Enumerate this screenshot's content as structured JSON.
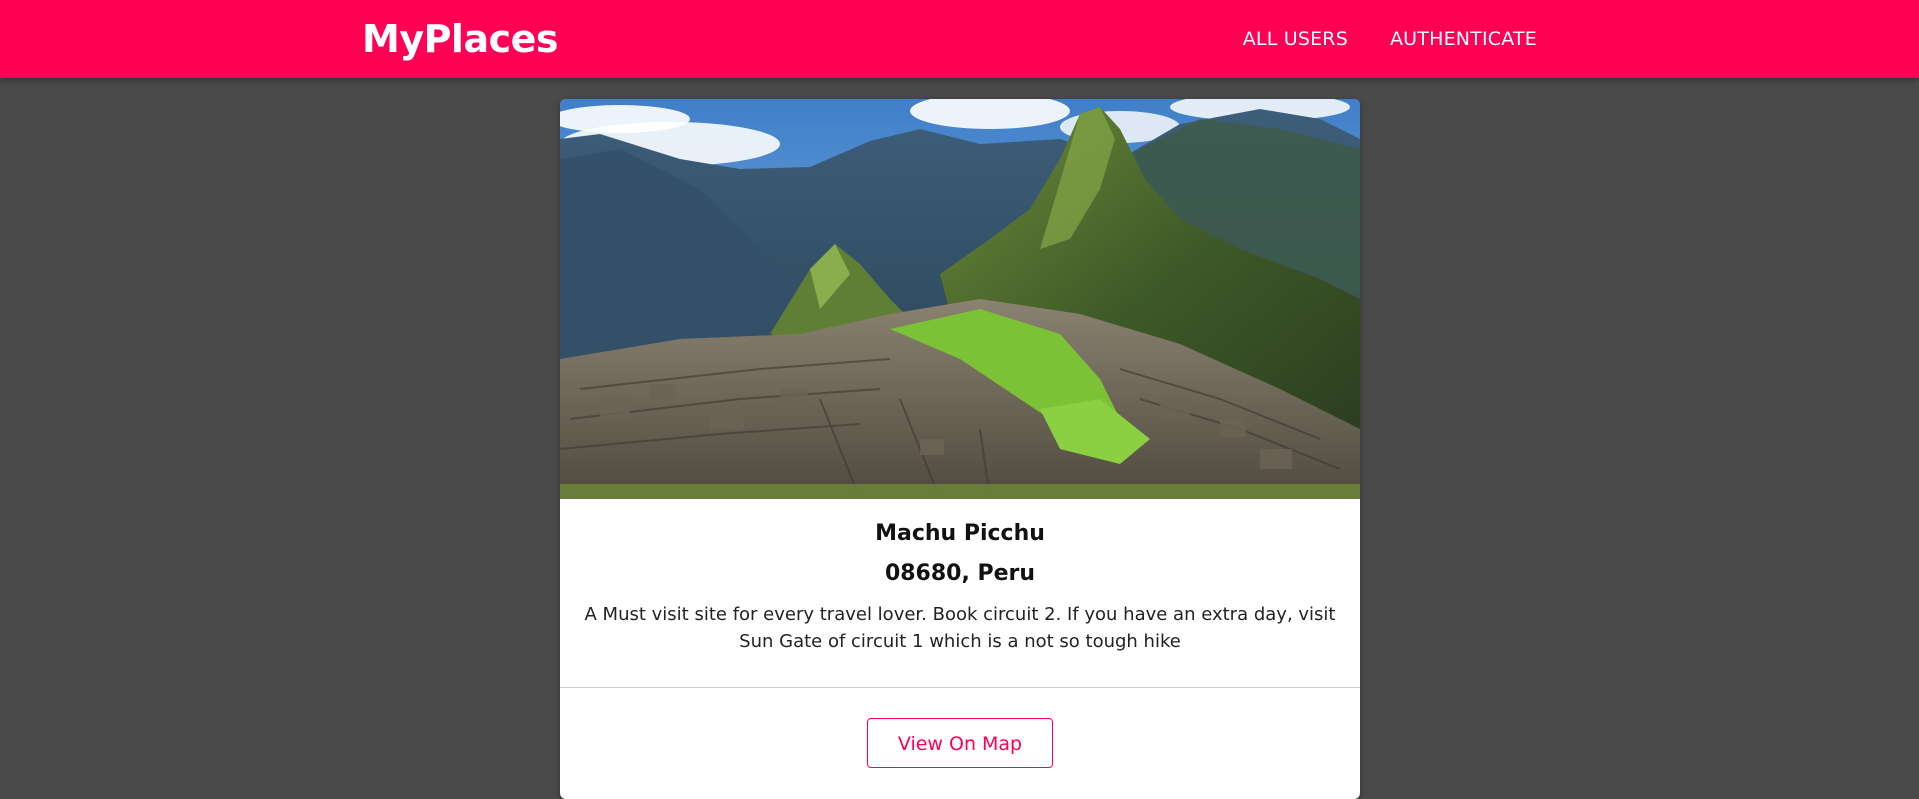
{
  "header": {
    "logo": "MyPlaces",
    "nav": [
      "ALL USERS",
      "AUTHENTICATE"
    ]
  },
  "place": {
    "title": "Machu Picchu",
    "address": "08680, Peru",
    "description": "A Must visit site for every travel lover. Book circuit 2. If you have an extra day, visit Sun Gate of circuit 1 which is a not so tough hike",
    "actions": {
      "view_map_label": "View On Map"
    }
  },
  "colors": {
    "brand": "#ff0055",
    "background": "#4a4a4a",
    "card": "#ffffff"
  }
}
